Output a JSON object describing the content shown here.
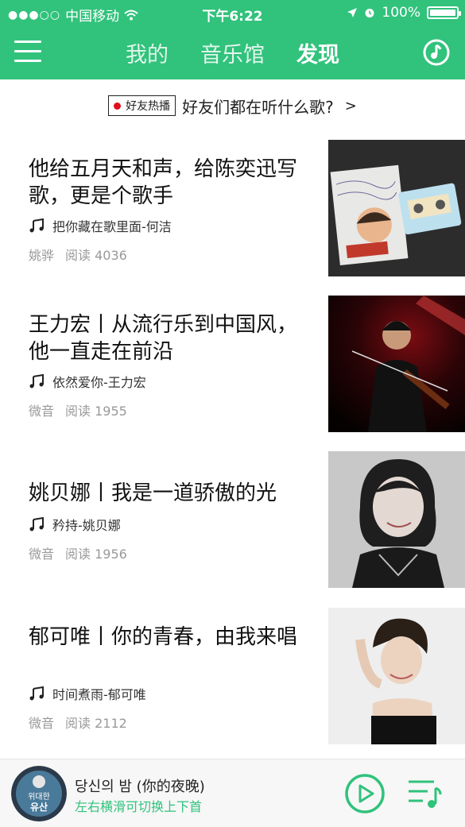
{
  "status_bar": {
    "carrier": "中国移动",
    "time": "下午6:22",
    "battery_text": "100%",
    "battery_level": 1.0
  },
  "nav": {
    "tabs": [
      {
        "label": "我的",
        "active": false
      },
      {
        "label": "音乐馆",
        "active": false
      },
      {
        "label": "发现",
        "active": true
      }
    ]
  },
  "friends_bar": {
    "badge": "好友热播",
    "text": "好友们都在听什么歌?",
    "arrow": ">"
  },
  "articles": [
    {
      "title": "他给五月天和声，给陈奕迅写歌，更是个歌手",
      "song": "把你藏在歌里面-何洁",
      "author": "姚骅",
      "reads": "阅读 4036"
    },
    {
      "title": "王力宏丨从流行乐到中国风，他一直走在前沿",
      "song": "依然爱你-王力宏",
      "author": "微音",
      "reads": "阅读 1955"
    },
    {
      "title": "姚贝娜丨我是一道骄傲的光",
      "song": "矜持-姚贝娜",
      "author": "微音",
      "reads": "阅读 1956"
    },
    {
      "title": "郁可唯丨你的青春，由我来唱",
      "song": "时间煮雨-郁可唯",
      "author": "微音",
      "reads": "阅读 2112"
    }
  ],
  "mini_player": {
    "song_title": "당신의 밤 (你的夜晚)",
    "hint": "左右横滑可切换上下首",
    "cover_text_top": "위대한",
    "cover_text_bottom": "유산"
  },
  "colors": {
    "brand": "#31c27c",
    "live_dot": "#e0101c"
  }
}
